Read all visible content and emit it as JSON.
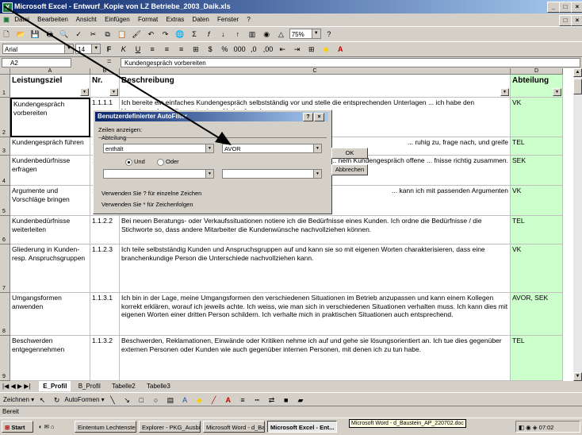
{
  "window": {
    "title": "Microsoft Excel - Entwurf_Kopie von LZ Betriebe_2003_Daik.xls",
    "controls": [
      "_",
      "□",
      "×"
    ]
  },
  "menu": [
    "Datei",
    "Bearbeiten",
    "Ansicht",
    "Einfügen",
    "Format",
    "Extras",
    "Daten",
    "Fenster",
    "?"
  ],
  "toolbar": {
    "zoom": "75%",
    "font": "Arial",
    "size": "14"
  },
  "formula_bar": {
    "name_box": "A2",
    "fx_symbol": "=",
    "content": "Kundengespräch vorbereiten"
  },
  "columns": [
    "A",
    "B",
    "C",
    "D"
  ],
  "header_row": {
    "row_num": "1",
    "leistungsziel": "Leistungsziel",
    "nr": "Nr.",
    "beschreibung": "Beschreibung",
    "abteilung": "Abteilung"
  },
  "rows": [
    {
      "num": "2",
      "ziel": "Kundengespräch vorbereiten",
      "nr": "1.1.1.1",
      "text": "Ich bereite ein einfaches Kundengespräch selbstständig vor und stelle die entsprechenden Unterlagen ... ich habe den Vorgehensplan selber ... in einem Verkaufs- oder",
      "abt": "VK"
    },
    {
      "num": "3",
      "ziel": "Kundengespräch führen",
      "nr": "1.",
      "text": "... ruhig zu, frage nach, und greife",
      "abt": "TEL"
    },
    {
      "num": "4",
      "ziel": "Kundenbedürfnisse erfragen",
      "nr": "1.",
      "text": "... nem Kundengespräch offene ... fnisse richtig zusammen.",
      "abt": "SEK"
    },
    {
      "num": "5",
      "ziel": "Argumente und Vorschläge bringen",
      "nr": "1",
      "text": "... kann ich mit passenden Argumenten",
      "abt": "VK"
    },
    {
      "num": "6",
      "ziel": "Kundenbedürfnisse weiterleiten",
      "nr": "1.1.2.2",
      "text": "Bei neuen Beratungs- oder Verkaufssituationen notiere ich die Bedürfnisse eines Kunden. Ich ordne die Bedürfnisse / die Stichworte so, dass andere Mitarbeiter die Kundenwünsche nachvollziehen können.",
      "abt": "TEL"
    },
    {
      "num": "7",
      "ziel": "Gliederung in Kunden- resp. Anspruchsgruppen",
      "nr": "1.1.2.3",
      "text": "Ich teile selbstständig Kunden und Anspruchsgruppen auf und kann sie so mit eigenen Worten charakterisieren, dass eine branchenkundige Person die Unterschiede nachvollziehen kann.",
      "abt": "VK"
    },
    {
      "num": "8",
      "ziel": "Umgangsformen anwenden",
      "nr": "1.1.3.1",
      "text": "Ich bin in der Lage, meine Umgangsformen den verschiedenen Situationen im Betrieb anzupassen und kann einem Kollegen korrekt erklären, worauf ich jeweils achte. Ich weiss, wie man sich in verschiedenen Situationen verhalten muss. Ich kann dies mit eigenen Worten einer dritten Person schildern. Ich verhalte mich in praktischen Situationen auch entsprechend.",
      "abt": "AVOR, SEK"
    },
    {
      "num": "9",
      "ziel": "Beschwerden entgegennehmen",
      "nr": "1.1.3.2",
      "text": "Beschwerden, Reklamationen, Einwände oder Kritiken nehme ich auf und gehe sie lösungsorientiert an. Ich tue dies gegenüber externen Personen oder Kunden wie auch gegenüber internen Personen, mit denen ich zu tun habe.",
      "abt": "TEL"
    }
  ],
  "dialog": {
    "title": "Benutzerdefinierter AutoFilter",
    "help": "?",
    "close": "×",
    "show_rows": "Zeilen anzeigen:",
    "field": "Abteilung",
    "op1": "enthält",
    "val1": "AVOR",
    "and_label": "Und",
    "or_label": "Oder",
    "op2": "",
    "val2": "",
    "hint1": "Verwenden Sie ? für einzelne Zeichen",
    "hint2": "Verwenden Sie * für Zeichenfolgen",
    "ok": "OK",
    "cancel": "Abbrechen"
  },
  "sheet_tabs": [
    "E_Profil",
    "B_Profil",
    "Tabelle2",
    "Tabelle3"
  ],
  "drawbar": {
    "draw": "Zeichnen ▾",
    "autoforms": "AutoFormen ▾"
  },
  "status": "Bereit",
  "taskbar": {
    "start": "Start",
    "items": [
      "Eintentum Lechtenstein |",
      "Explorer - PKG_Ausbildun",
      "Microsoft Word - d_Baustei",
      "Microsoft Excel - Ent..."
    ],
    "tooltip": "Microsoft Word - d_Baustein_AP_220702.doc",
    "clock": "07:02"
  }
}
